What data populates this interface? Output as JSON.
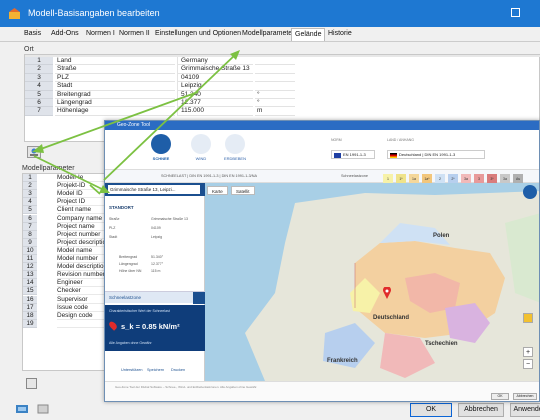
{
  "window": {
    "title": "Modell-Basisangaben bearbeiten"
  },
  "tabs": [
    "Basis",
    "Add-Ons",
    "Normen I",
    "Normen II",
    "Einstellungen und Optionen",
    "Modellparameter",
    "Gelände",
    "Historie"
  ],
  "active_tab": "Gelände",
  "grid1": {
    "group_label": "Ort",
    "rows": [
      {
        "n": "1",
        "label": "Land",
        "value": "Germany",
        "unit": ""
      },
      {
        "n": "2",
        "label": "Straße",
        "value": "Grimmaische Straße 13",
        "unit": ""
      },
      {
        "n": "3",
        "label": "PLZ",
        "value": "04109",
        "unit": ""
      },
      {
        "n": "4",
        "label": "Stadt",
        "value": "Leipzig",
        "unit": ""
      },
      {
        "n": "5",
        "label": "Breitengrad",
        "value": "51.340",
        "unit": "°"
      },
      {
        "n": "6",
        "label": "Längengrad",
        "value": "12.377",
        "unit": "°"
      },
      {
        "n": "7",
        "label": "Höhenlage",
        "value": "115.000",
        "unit": "m"
      }
    ]
  },
  "grid2": {
    "group_label": "Modellparameter",
    "rows": [
      {
        "n": "1",
        "label": "Modell-Ie"
      },
      {
        "n": "2",
        "label": "Projekt-ID"
      },
      {
        "n": "3",
        "label": "Model ID"
      },
      {
        "n": "4",
        "label": "Project ID"
      },
      {
        "n": "5",
        "label": "Client name"
      },
      {
        "n": "6",
        "label": "Company name"
      },
      {
        "n": "7",
        "label": "Project name"
      },
      {
        "n": "8",
        "label": "Project number"
      },
      {
        "n": "9",
        "label": "Project descriptio"
      },
      {
        "n": "10",
        "label": "Model name"
      },
      {
        "n": "11",
        "label": "Model number"
      },
      {
        "n": "12",
        "label": "Model descriptio"
      },
      {
        "n": "13",
        "label": "Revision number"
      },
      {
        "n": "14",
        "label": "Engineer"
      },
      {
        "n": "15",
        "label": "Checker"
      },
      {
        "n": "16",
        "label": "Supervisor"
      },
      {
        "n": "17",
        "label": "Issue code"
      },
      {
        "n": "18",
        "label": "Design code"
      },
      {
        "n": "19",
        "label": ""
      }
    ]
  },
  "buttons": {
    "ok": "OK",
    "cancel": "Abbrechen",
    "apply": "Anwenden"
  },
  "browser": {
    "title": "Geo-Zone Tool",
    "load_buttons": [
      "SCHNEE",
      "WIND",
      "ERDBEBEN"
    ],
    "norm_label": "NORM",
    "norm_value": "EN 1991-1-3",
    "country_label": "LAND / ANHANG",
    "country_value": "Deutschland | DIN EN 1991-1-3",
    "breadcrumb": "SCHNEELAST | DIN EN 1991-1-3 | DIN EN 1991-1-3/NA",
    "zone_label": "Schneelastzone",
    "zones": [
      "1",
      "1*",
      "1a",
      "1a*",
      "2",
      "2*",
      "3a",
      "3",
      "3*",
      "3a",
      "As"
    ],
    "zone_colors": [
      "#f7f2a8",
      "#efe38a",
      "#f4d79a",
      "#f2c67b",
      "#cfe1f4",
      "#b7cfee",
      "#f1b9b9",
      "#e89a9a",
      "#d97c7c",
      "#c8c8c8",
      "#b0b0b0"
    ],
    "search_value": "Grimmaische Straße 13, Leipzi...",
    "map_tabs": [
      "Karte",
      "Satellit"
    ],
    "section_title": "STANDORT",
    "location_rows": [
      {
        "k": "Straße",
        "v": "Grimmaische Straße 13"
      },
      {
        "k": "PLZ",
        "v": "04109"
      },
      {
        "k": "Stadt",
        "v": "Leipzig"
      }
    ],
    "coord_rows": [
      {
        "k": "Breitengrad",
        "v": "51.340°"
      },
      {
        "k": "Längengrad",
        "v": "12.377°"
      },
      {
        "k": "Höhe über NN",
        "v": "115 m"
      }
    ],
    "snow_zone_label": "Schneelastzone",
    "result_header": "Charakteristischer Wert der Schneelast",
    "result_value": "s_k = 0.85 kN/m²",
    "result_note": "Alle Angaben ohne Gewähr",
    "footer_links": [
      "Unterstützen",
      "Speichern",
      "Drucken"
    ],
    "map_labels": [
      "Polen",
      "Deutschland",
      "Frankreich",
      "Tschechien"
    ],
    "footer_text": "Geo-Zone Tool der Dlubal Software – Schnee-, Wind- und Erdbebenlastzonen. Alle Angaben ohne Gewähr.",
    "btn_ok": "OK",
    "btn_cancel": "Abbrechen"
  }
}
